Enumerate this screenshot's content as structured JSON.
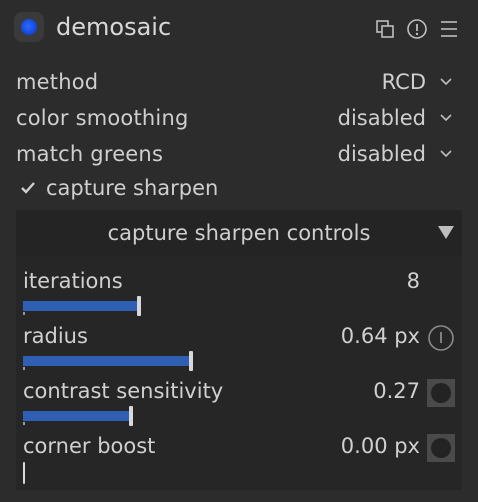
{
  "module": {
    "title": "demosaic",
    "power_on": true,
    "power_color": "#1f5cf0",
    "header_icons": [
      "presets-copy-icon",
      "info-icon",
      "menu-icon"
    ]
  },
  "settings": [
    {
      "label": "method",
      "value": "RCD"
    },
    {
      "label": "color smoothing",
      "value": "disabled"
    },
    {
      "label": "match greens",
      "value": "disabled"
    }
  ],
  "capture_sharpen": {
    "label": "capture sharpen",
    "checked": true
  },
  "controls": {
    "title": "capture sharpen controls",
    "accent": "#2f5fb3",
    "sliders": [
      {
        "label": "iterations",
        "value": "8",
        "level": 0.29,
        "icon": ""
      },
      {
        "label": "radius",
        "value": "0.64 px",
        "level": 0.42,
        "icon": "info-circle-icon"
      },
      {
        "label": "contrast sensitivity",
        "value": "0.27",
        "level": 0.27,
        "icon": "mask-toggle-icon"
      },
      {
        "label": "corner boost",
        "value": "0.00 px",
        "level": 0.0,
        "icon": "mask-toggle-icon"
      }
    ]
  }
}
